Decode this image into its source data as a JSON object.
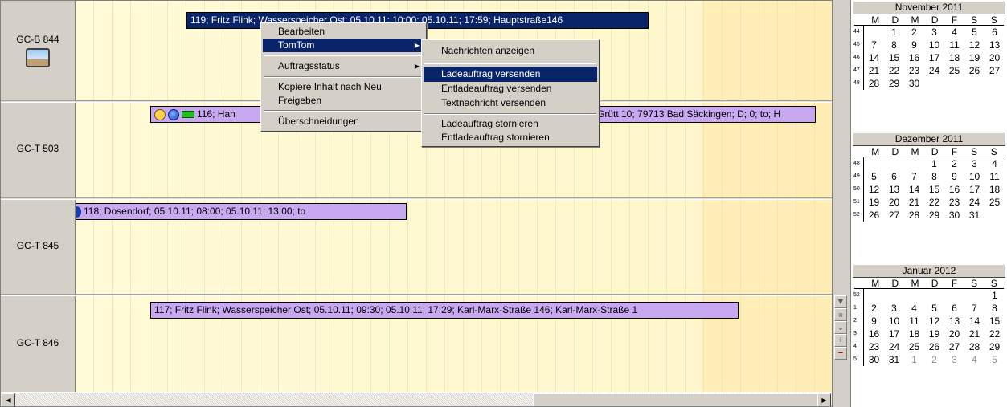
{
  "resources": [
    {
      "name": "GC-B 844",
      "icon": "gps-device-icon"
    },
    {
      "name": "GC-T 503"
    },
    {
      "name": "GC-T 845"
    },
    {
      "name": "GC-T 846"
    }
  ],
  "jobs": [
    {
      "text": "119; Fritz Flink; Wasserspeicher Ost; 05.10.11; 10:00; 05.10.11; 17:59;  Hauptstraße146",
      "color": "#0a246a"
    },
    {
      "text": "116; Hans; ...; Grütt 10; 79713 Bad Säckingen; D; 0; to; H",
      "before_menu": "116; Han",
      "after_menu": "Grütt 10; 79713 Bad Säckingen; D; 0; to; H",
      "color": "#c8a8f0"
    },
    {
      "text": "118; Dosendorf; 05.10.11; 08:00; 05.10.11; 13:00; to",
      "color": "#c8a8f0"
    },
    {
      "text": "117; Fritz Flink; Wasserspeicher Ost; 05.10.11; 09:30; 05.10.11; 17:29; Karl-Marx-Straße 146; Karl-Marx-Straße 1",
      "color": "#c8a8f0"
    }
  ],
  "context_menu": {
    "items": [
      "Bearbeiten",
      "TomTom",
      "Auftragsstatus",
      "Kopiere Inhalt nach Neu",
      "Freigeben",
      "Überschneidungen"
    ],
    "highlighted": "TomTom"
  },
  "submenu": {
    "items": [
      "Nachrichten anzeigen",
      "Ladeauftrag versenden",
      "Entladeauftrag versenden",
      "Textnachricht versenden",
      "Ladeauftrag stornieren",
      "Entladeauftrag stornieren"
    ],
    "highlighted": "Ladeauftrag versenden"
  },
  "toolbar": {
    "btn1": "▼",
    "btn2": "⌅",
    "btn3": "⌄",
    "btn4": "+",
    "btn5": "−"
  },
  "calendar": {
    "dow": [
      "M",
      "D",
      "M",
      "D",
      "F",
      "S",
      "S"
    ],
    "months": [
      {
        "title": "November 2011",
        "weeks": [
          {
            "wk": "44",
            "days": [
              "",
              "1",
              "2",
              "3",
              "4",
              "5",
              "6"
            ]
          },
          {
            "wk": "45",
            "days": [
              "7",
              "8",
              "9",
              "10",
              "11",
              "12",
              "13"
            ]
          },
          {
            "wk": "46",
            "days": [
              "14",
              "15",
              "16",
              "17",
              "18",
              "19",
              "20"
            ]
          },
          {
            "wk": "47",
            "days": [
              "21",
              "22",
              "23",
              "24",
              "25",
              "26",
              "27"
            ]
          },
          {
            "wk": "48",
            "days": [
              "28",
              "29",
              "30",
              "",
              "",
              "",
              ""
            ]
          }
        ]
      },
      {
        "title": "Dezember 2011",
        "weeks": [
          {
            "wk": "48",
            "days": [
              "",
              "",
              "",
              "1",
              "2",
              "3",
              "4"
            ]
          },
          {
            "wk": "49",
            "days": [
              "5",
              "6",
              "7",
              "8",
              "9",
              "10",
              "11"
            ]
          },
          {
            "wk": "50",
            "days": [
              "12",
              "13",
              "14",
              "15",
              "16",
              "17",
              "18"
            ]
          },
          {
            "wk": "51",
            "days": [
              "19",
              "20",
              "21",
              "22",
              "23",
              "24",
              "25"
            ]
          },
          {
            "wk": "52",
            "days": [
              "26",
              "27",
              "28",
              "29",
              "30",
              "31",
              ""
            ]
          }
        ]
      },
      {
        "title": "Januar 2012",
        "weeks": [
          {
            "wk": "52",
            "days": [
              "",
              "",
              "",
              "",
              "",
              "",
              "1"
            ]
          },
          {
            "wk": "1",
            "days": [
              "2",
              "3",
              "4",
              "5",
              "6",
              "7",
              "8"
            ]
          },
          {
            "wk": "2",
            "days": [
              "9",
              "10",
              "11",
              "12",
              "13",
              "14",
              "15"
            ]
          },
          {
            "wk": "3",
            "days": [
              "16",
              "17",
              "18",
              "19",
              "20",
              "21",
              "22"
            ]
          },
          {
            "wk": "4",
            "days": [
              "23",
              "24",
              "25",
              "26",
              "27",
              "28",
              "29"
            ]
          },
          {
            "wk": "5",
            "days": [
              "30",
              "31",
              "1",
              "2",
              "3",
              "4",
              "5"
            ],
            "other_from": 2
          }
        ]
      }
    ]
  }
}
